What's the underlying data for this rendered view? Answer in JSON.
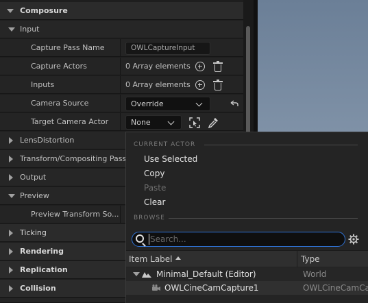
{
  "details": {
    "categories": {
      "composure": "Composure",
      "input": "Input",
      "lens_distortion": "LensDistortion",
      "transform": "Transform/Compositing Passe",
      "output": "Output",
      "preview": "Preview",
      "ticking": "Ticking",
      "rendering": "Rendering",
      "replication": "Replication",
      "collision": "Collision"
    },
    "properties": {
      "capture_pass_name": {
        "label": "Capture Pass Name",
        "value": "OWLCaptureInput"
      },
      "capture_actors": {
        "label": "Capture Actors",
        "value": "0 Array elements"
      },
      "inputs": {
        "label": "Inputs",
        "value": "0 Array elements"
      },
      "camera_source": {
        "label": "Camera Source",
        "value": "Override"
      },
      "target_camera_actor": {
        "label": "Target Camera Actor",
        "value": "None"
      },
      "preview_transform_source": {
        "label": "Preview Transform So..."
      }
    }
  },
  "menu": {
    "current_actor_header": "CURRENT ACTOR",
    "items": {
      "use_selected": "Use Selected",
      "copy": "Copy",
      "paste": "Paste",
      "clear": "Clear"
    },
    "browse_header": "BROWSE",
    "search": {
      "placeholder": "Search...",
      "value": ""
    },
    "table": {
      "col_label": "Item Label",
      "col_type": "Type",
      "rows": [
        {
          "label": "Minimal_Default (Editor)",
          "type": "World"
        },
        {
          "label": "OWLCineCamCapture1",
          "type": "OWLCineCamCa"
        }
      ]
    }
  },
  "colors": {
    "accent": "#2f73d8",
    "panel_bg": "#242424",
    "category_bg": "#2b2b2b"
  }
}
